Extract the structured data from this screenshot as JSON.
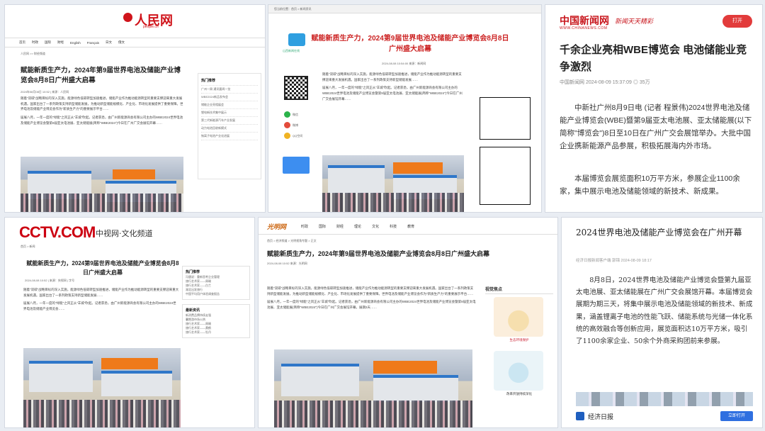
{
  "colors": {
    "renmin_red": "#d0141b",
    "chinanews_red": "#c8161d",
    "gmw_red": "#d33",
    "blue": "#2f6fe0"
  },
  "p1": {
    "logo": "人民网",
    "logo_sub": "people.cn",
    "nav": [
      "首页",
      "时政",
      "国际",
      "财经",
      "English",
      "Français",
      "日文",
      "俄文"
    ],
    "crumb": "人民网 >> 财经频道",
    "title": "赋能新质生产力，2024年第9届世界电池及储能产业博览会8月8日广州盛大启幕",
    "meta": "2024年08月08日 10:52 | 来源：人民网",
    "body": "随着\"双碳\"战略目标的深入实施，能源绿色低碳转型加速推进，储能产业作为推动能源转型的重要支撑迎来重大发展机遇。国家出台了一系列政策支持新型储能发展，为推动新型储能规模化、产业化、市场化发展提供了重要保障。世界电池及储能产业博览会作为\"新质生产力\"的重要展示平台……",
    "body2": "届展八月，一年一度的\"绿能\"之风正从\"羊城\"吹起。记者获悉，由广州新能源商会有限公司主办的WBE2024世界电池及储能产业博览会暨第9届亚太电池展、亚太储能展(简称\"WBE2024\")今日在广州广交会展馆开幕……",
    "side_title": "热门推荐",
    "side": [
      "广州一周·通讯要闻一览",
      "WBE2024新品发布会",
      "储能企业亮相展会",
      "锂电新技术集中展示",
      "第三代新能源汽车产业发展",
      "动力电池回收新模式",
      "钠离子电池产业化进展"
    ]
  },
  "p2": {
    "topbar": "您当前位置：首页 > 新闻资讯",
    "logo_text": "山西新闻在线",
    "title": "赋能新质生产力，2024第9届世界电池及储能产业博览会8月8日广州盛大启幕",
    "meta": "2024-08-08 10:54:00  来源：新闻网",
    "share": [
      "微信",
      "微博",
      "QQ空间"
    ],
    "body": "随着\"双碳\"战略目标的深入实施，能源绿色低碳转型加速推进，储能产业作为推动能源转型的重要支撑迎来重大发展机遇。国家出台了一系列政策支持新型储能发展……",
    "body2": "届展八月，一年一度的\"绿能\"之风正从\"羊城\"吹起。记者获悉，由广州新能源商会有限公司主办的WBE2024世界电池及储能产业博览会暨第9届亚太电池展、亚太储能展(简称\"WBE2024\")今日在广州广交会展馆开幕……"
  },
  "p3": {
    "logo": "中国新闻网",
    "logo_en": "WWW.CHINANEWS.COM",
    "slogan": "新闻天天精彩",
    "open_label": "打开",
    "title": "千余企业亮相WBE博览会 电池储能业竞争激烈",
    "meta": "中国新闻网 2024-08-09 15:37:09  ◎ 35万",
    "body": "中新社广州8月9日电 (记者 程景伟)2024世界电池及储能产业博览会(WBE)暨第9届亚太电池展、亚太储能展(以下简称\"博览会\")8日至10日在广州广交会展馆举办。大批中国企业携新能源产品参展，积极拓展海内外市场。",
    "body2": "本届博览会展览面积10万平方米，参展企业1100余家，集中展示电池及储能领域的新技术、新成果。"
  },
  "p4": {
    "logo": "CCTV.COM",
    "logo2": "中视网·文化频道",
    "crumb": "首页 > 新闻",
    "title": "赋能新质生产力，2024第9届世界电池及储能产业博览会8月8日广州盛大启幕",
    "meta": "2024-08-08 10:52 | 来源：央视网 | 字号",
    "body": "随着\"双碳\"战略目标的深入实施，能源绿色低碳转型加速推进，储能产业作为推动能源转型的重要支撑迎来重大发展机遇。国家出台了一系列政策支持新型储能发展……",
    "body2": "届展八月，一年一度的\"绿能\"之风正从\"羊城\"吹起。记者获悉，由广州新能源商会有限公司主办的WBE2024世界电池及储能产业博览会……",
    "side_title1": "热门推荐",
    "side1": [
      "冯唐说：重新思考企业管理",
      "旅行艺术家——周瑜",
      "旅行艺术家——白兰",
      "湖北出发旅行",
      "中国平均用户体验调查报告"
    ],
    "side_title2": "最新资讯",
    "side2": [
      "新消费品牌持续走强",
      "暑期游市场火热",
      "旅行艺术家——周瑜",
      "旅行艺术家——黄鹤",
      "旅行艺术家——牡丹"
    ]
  },
  "p5": {
    "logo": "光明网",
    "nav": [
      "时政",
      "国际",
      "财经",
      "理论",
      "文化",
      "科技",
      "教育"
    ],
    "crumb": "首页 > 经济频道 > 光明视角专题 > 正文",
    "title": "赋能新质生产力，2024年第9届世界电池及储能产业博览会8月8日广州盛大启幕",
    "meta": "2024-08-08 10:52  来源：光明网",
    "body": "随着\"双碳\"战略目标的深入实施，能源绿色低碳转型加速推进，储能产业作为推动能源转型的重要支撑迎来重大发展机遇。国家出台了一系列政策支持新型储能发展，为推动新型储能规模化、产业化、市场化发展提供了重要保障。世界电池及储能产业博览会作为\"新质生产力\"的重要展示平台……",
    "body2": "届展八月，一年一度的\"绿能\"之风正从\"羊城\"吹起。记者获悉，由广州新能源商会有限公司主办的WBE2024世界电池及储能产业博览会暨第9届亚太电池展、亚太储能展(简称\"WBE2024\")今日在广州广交会展馆开幕，展期3天……",
    "right_title": "视觉焦点",
    "cap1": "生态环境保护",
    "cap2": "改革开放持续深化"
  },
  "p6": {
    "title": "2024世界电池及储能产业博览会在广州开幕",
    "meta": "经济日报新闻客户端  郭锦  2024-08-09 18:17",
    "body": "8月8日，2024世界电池及储能产业博览会暨第九届亚太电池展、亚太储能展在广州广交会展馆开幕。本届博览会展期为期三天，将集中展示电池及储能领域的新技术、新成果，涵盖锂离子电池的性能飞跃、储能系统与光储一体化系统的高效融合等创新应用，展览面积达10万平方米，吸引了1100余家企业、50余个外商采购团前来参展。",
    "footer_name": "经济日报",
    "footer_btn": "立即打开"
  }
}
